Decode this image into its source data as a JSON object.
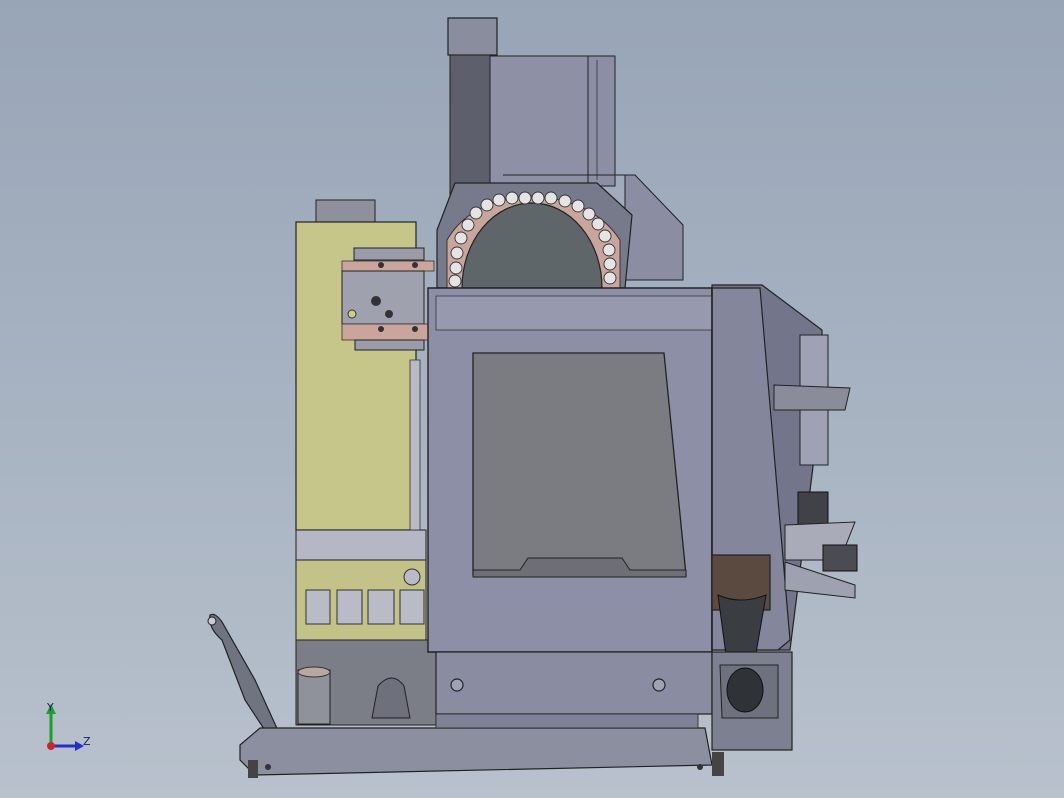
{
  "triad": {
    "y_label": "Y",
    "z_label": "Z"
  },
  "colors": {
    "background": "#a3afbe",
    "enclosure": "#8c8fa6",
    "enclosure_dark": "#73768b",
    "enclosure_light": "#a7aabd",
    "window": "#7b7c82",
    "tool_disc": "#5f6669",
    "tool_ring": "#c9a59c",
    "control_cabinet": "#c7c68a",
    "hopper": "#7a7d85",
    "chip_chute": "#3a3d41",
    "chip_chute_top": "#5a4a3f",
    "triad_y": "#1aa02b",
    "triad_z": "#2431c8",
    "triad_origin": "#c8262a"
  }
}
